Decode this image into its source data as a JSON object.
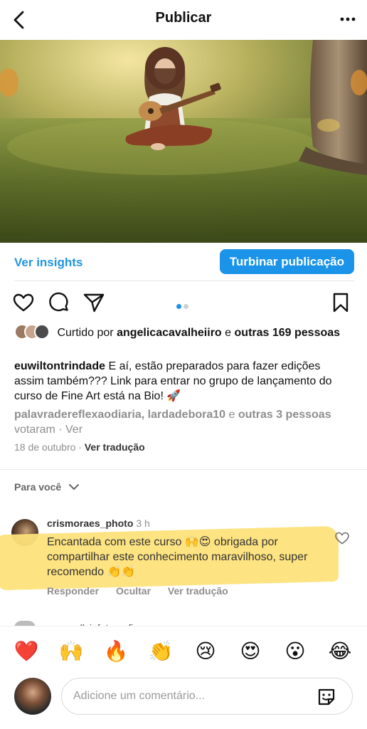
{
  "header": {
    "title": "Publicar"
  },
  "insights_row": {
    "insights_label": "Ver insights",
    "boost_label": "Turbinar publicação"
  },
  "likes": {
    "prefix": "Curtido por",
    "user": "angelicacavalheiiro",
    "joiner": "e",
    "others": "outras 169 pessoas"
  },
  "caption": {
    "user": "euwiltontrindade",
    "text": "E aí, estão preparados para fazer edições assim também??? Link para entrar no grupo de lançamento do curso de Fine Art está na Bio! 🚀"
  },
  "votes": {
    "users": "palavradereflexaodiaria, lardadebora10",
    "joiner": "e",
    "others": "outras 3 pessoas",
    "suffix": "votaram · Ver"
  },
  "meta": {
    "date": "18 de outubro",
    "sep": "·",
    "translate": "Ver tradução"
  },
  "for_you": {
    "label": "Para você"
  },
  "comment": {
    "user": "crismoraes_photo",
    "time": "3 h",
    "text": "Encantada com este curso 🙌😍 obrigada por compartilhar este conhecimento maravilhoso, super recomendo 👏👏",
    "reply": "Responder",
    "hide": "Ocultar",
    "translate": "Ver tradução"
  },
  "next_comment_peek": "_emmallyinfotografia_",
  "emojis": [
    "❤️",
    "🙌",
    "🔥",
    "👏",
    "😢",
    "😍",
    "😮",
    "😂"
  ],
  "composer": {
    "placeholder": "Adicione um comentário..."
  },
  "colors": {
    "accent": "#1a93e8",
    "link": "#2196e0",
    "highlight": "#fde27a",
    "muted": "#8e8e8e"
  },
  "carousel": {
    "count": 2,
    "active": 1
  },
  "icons": [
    "back-icon",
    "more-icon",
    "heart-icon",
    "comment-icon",
    "share-icon",
    "bookmark-icon",
    "chevron-down-icon",
    "sticker-icon"
  ]
}
